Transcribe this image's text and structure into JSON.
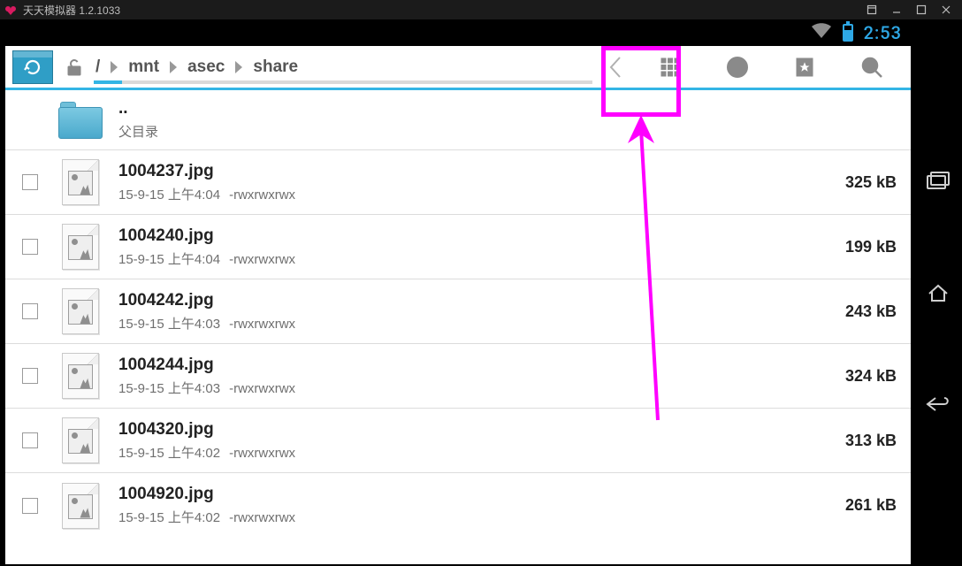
{
  "emulator_title": "天天模拟器 1.2.1033",
  "status": {
    "time": "2:53"
  },
  "breadcrumb": {
    "root": "/",
    "seg1": "mnt",
    "seg2": "asec",
    "seg3": "share"
  },
  "parent": {
    "name": "..",
    "sub": "父目录"
  },
  "files": [
    {
      "name": "1004237.jpg",
      "date": "15-9-15 上午4:04",
      "perm": "-rwxrwxrwx",
      "size": "325 kB"
    },
    {
      "name": "1004240.jpg",
      "date": "15-9-15 上午4:04",
      "perm": "-rwxrwxrwx",
      "size": "199 kB"
    },
    {
      "name": "1004242.jpg",
      "date": "15-9-15 上午4:03",
      "perm": "-rwxrwxrwx",
      "size": "243 kB"
    },
    {
      "name": "1004244.jpg",
      "date": "15-9-15 上午4:03",
      "perm": "-rwxrwxrwx",
      "size": "324 kB"
    },
    {
      "name": "1004320.jpg",
      "date": "15-9-15 上午4:02",
      "perm": "-rwxrwxrwx",
      "size": "313 kB"
    },
    {
      "name": "1004920.jpg",
      "date": "15-9-15 上午4:02",
      "perm": "-rwxrwxrwx",
      "size": "261 kB"
    }
  ]
}
